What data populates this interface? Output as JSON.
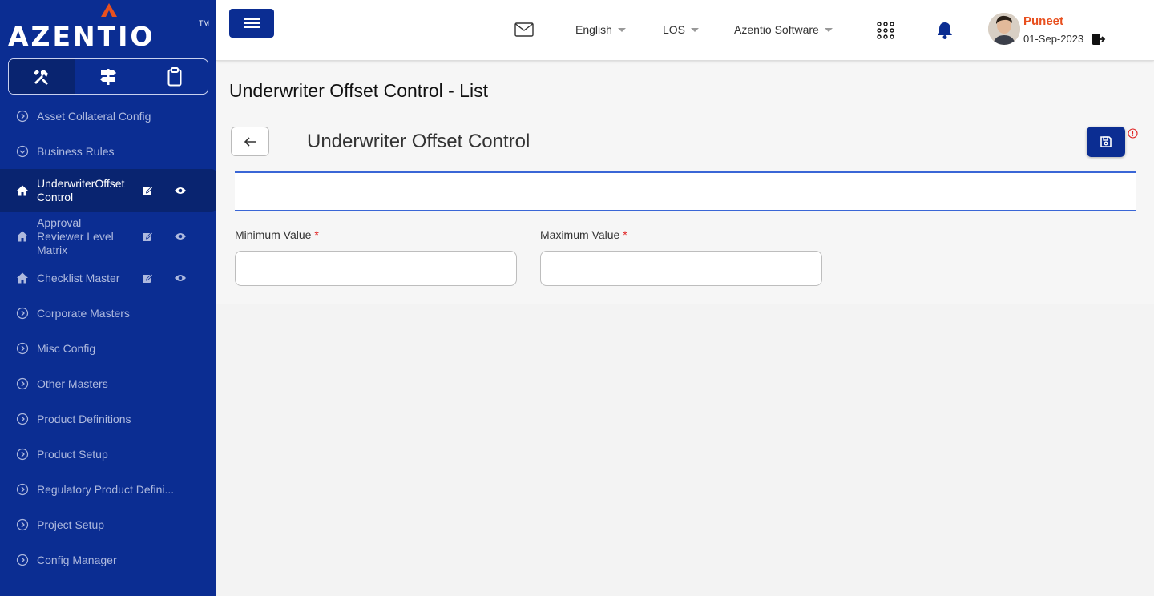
{
  "brand": {
    "name": "AZENTIO",
    "trademark": "TM",
    "accent": "#e8501f",
    "primary": "#0b2d92"
  },
  "sidebar": {
    "tabs": [
      {
        "icon": "tools-icon",
        "active": true
      },
      {
        "icon": "signpost-icon",
        "active": false
      },
      {
        "icon": "clipboard-icon",
        "active": false
      }
    ],
    "items": [
      {
        "label": "Asset Collateral Config"
      },
      {
        "label": "Business Rules"
      },
      {
        "label": "UnderwriterOffsetControl"
      },
      {
        "label": "Approval Reviewer Level Matrix"
      },
      {
        "label": "Checklist Master"
      },
      {
        "label": "Corporate Masters"
      },
      {
        "label": "Misc Config"
      },
      {
        "label": "Other Masters"
      },
      {
        "label": "Product Definitions"
      },
      {
        "label": "Product Setup"
      },
      {
        "label": "Regulatory Product Defini..."
      },
      {
        "label": "Project Setup"
      },
      {
        "label": "Config Manager"
      }
    ]
  },
  "header": {
    "language": "English",
    "module": "LOS",
    "company": "Azentio Software",
    "user": {
      "name": "Puneet",
      "date": "01-Sep-2023"
    }
  },
  "main": {
    "page_title": "Underwriter Offset Control - List",
    "section_title": "Underwriter Offset Control",
    "fields": [
      {
        "label": "Minimum Value",
        "required_mark": "*",
        "value": ""
      },
      {
        "label": "Maximum Value",
        "required_mark": "*",
        "value": ""
      }
    ]
  }
}
